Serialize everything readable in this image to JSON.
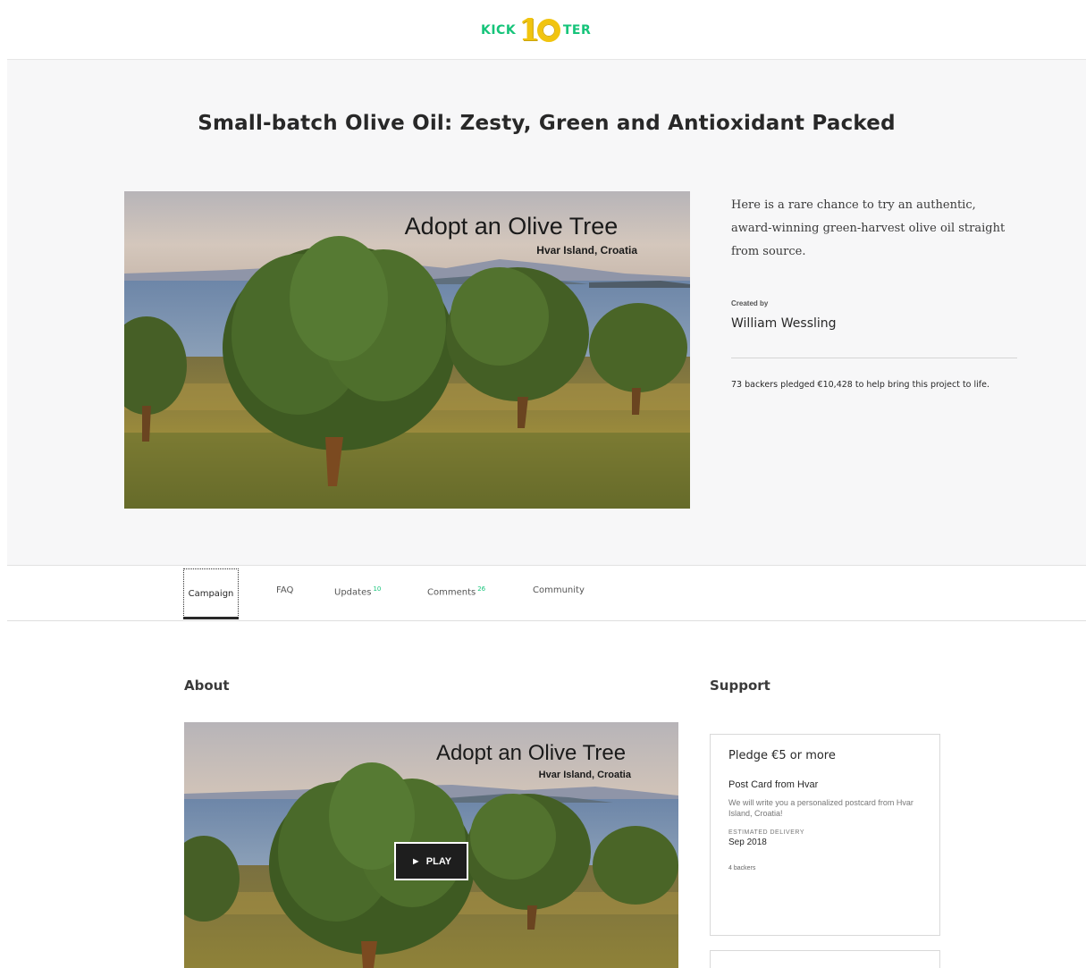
{
  "header": {
    "logo_left": "KICK",
    "logo_one": "1",
    "logo_right": "TER"
  },
  "hero": {
    "title": "Small-batch Olive Oil: Zesty, Green and Antioxidant Packed",
    "image_title": "Adopt an Olive Tree",
    "image_subtitle": "Hvar Island, Croatia",
    "blurb": "Here is a rare chance to try an authentic, award-winning green-harvest olive oil straight from source.",
    "created_by_label": "Created by",
    "creator": "William Wessling",
    "funded": "73 backers pledged €10,428 to help bring this project to life."
  },
  "nav": {
    "campaign": "Campaign",
    "faq": "FAQ",
    "updates": "Updates",
    "updates_count": "10",
    "comments": "Comments",
    "comments_count": "26",
    "community": "Community"
  },
  "about": {
    "heading": "About",
    "video_title": "Adopt an Olive Tree",
    "video_subtitle": "Hvar Island, Croatia",
    "play_label": "PLAY"
  },
  "support": {
    "heading": "Support",
    "reward": {
      "pledge": "Pledge €5 or more",
      "title": "Post Card from Hvar",
      "description": "We will write you a personalized postcard from Hvar Island, Croatia!",
      "delivery_label": "ESTIMATED DELIVERY",
      "delivery_date": "Sep 2018",
      "backers": "4 backers"
    }
  },
  "colors": {
    "brand_green": "#16c47a",
    "logo_gold": "#f1c40f",
    "hero_bg": "#f7f7f8"
  }
}
